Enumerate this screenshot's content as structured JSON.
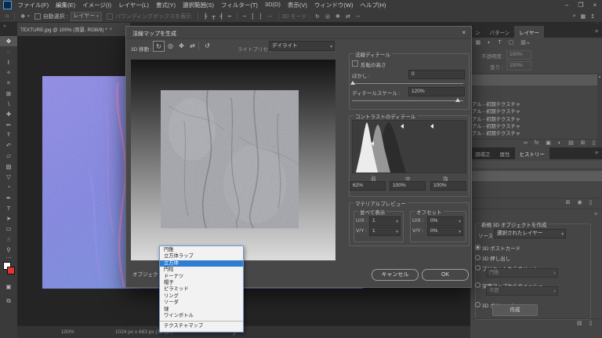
{
  "colors": {
    "accent_blue": "#2e7dd1",
    "selection_highlight": "#2e7dd1",
    "foreground_swatch": "#ffffff",
    "background_swatch": "#e23232",
    "normalmap_base": "#7d7fe4",
    "normalmap_streak": "#ec7fd0"
  },
  "ui": {
    "caret": "▾"
  },
  "window_controls": {
    "minimize": "–",
    "restore": "❐",
    "close": "×"
  },
  "menu_bar": {
    "items": [
      "ファイル(F)",
      "編集(E)",
      "イメージ(I)",
      "レイヤー(L)",
      "書式(Y)",
      "選択範囲(S)",
      "フィルター(T)",
      "3D(D)",
      "表示(V)",
      "ウィンドウ(W)",
      "ヘルプ(H)"
    ]
  },
  "options_bar": {
    "home_icon": "⌂",
    "move_icon": "✥",
    "auto_select_label": "自動選択 :",
    "auto_select_value": "レイヤー",
    "bounding_box_label": "バウンディングボックスを表示",
    "align_icons": [
      "┣",
      "┳",
      "┫",
      "━"
    ],
    "distribute_icons": [
      "┅",
      "┇",
      "┋"
    ],
    "more_icon": "⋯",
    "mode_label": "3D モード :",
    "mode_icons": [
      "↻",
      "◎",
      "✥",
      "⇄",
      "↔"
    ],
    "search_icon": "⌕",
    "layout_icon": "▦",
    "share_icon": "↥"
  },
  "document_tab": {
    "title": "TEXTURE.jpg @ 100% (背景, RGB/8) *",
    "close_icon": "×"
  },
  "toolbar": {
    "collapse_icon": "»",
    "tools": [
      {
        "name": "move",
        "glyph": "✥",
        "selected": true
      },
      {
        "name": "marquee",
        "glyph": "◌"
      },
      {
        "name": "lasso",
        "glyph": "ℓ"
      },
      {
        "name": "quick-select",
        "glyph": "✧"
      },
      {
        "name": "crop",
        "glyph": "⌗"
      },
      {
        "name": "frame",
        "glyph": "⊠"
      },
      {
        "name": "eyedropper",
        "glyph": "∖"
      },
      {
        "name": "healing",
        "glyph": "✚"
      },
      {
        "name": "brush",
        "glyph": "✏"
      },
      {
        "name": "clone-stamp",
        "glyph": "⍒"
      },
      {
        "name": "history-brush",
        "glyph": "↶"
      },
      {
        "name": "eraser",
        "glyph": "▱"
      },
      {
        "name": "gradient",
        "glyph": "▨"
      },
      {
        "name": "blur",
        "glyph": "▽"
      },
      {
        "name": "dodge",
        "glyph": "◔"
      },
      {
        "name": "pen",
        "glyph": "✒"
      },
      {
        "name": "type",
        "glyph": "T"
      },
      {
        "name": "path-select",
        "glyph": "➤"
      },
      {
        "name": "shape",
        "glyph": "▭"
      },
      {
        "name": "hand",
        "glyph": "☝"
      },
      {
        "name": "zoom",
        "glyph": "⚲"
      }
    ],
    "more_icon": "⋯",
    "quickmask_icon": "▣",
    "screenmode_icon": "⧉"
  },
  "dialog": {
    "title": "法線マップを生成",
    "close_icon": "×",
    "move_label": "3D 移動 :",
    "move_icons": [
      "↻",
      "◎",
      "✥",
      "⇄"
    ],
    "reset_icon": "↺",
    "light_preset_label": "ライトプリセット :",
    "light_preset_value": "デイライト",
    "object_label": "オブジェクト :",
    "normal_detail": {
      "title": "法線ディテール",
      "invert_label": "反転の高さ",
      "blur_label": "ぼかし :",
      "blur_value": "0",
      "scale_label": "ディテールスケール :",
      "scale_value": "120%"
    },
    "contrast": {
      "title": "コントラストのディテール",
      "tick_labels": [
        "弱",
        "中",
        "強"
      ],
      "values": [
        "62%",
        "100%",
        "100%"
      ]
    },
    "material": {
      "title": "マテリアルプレビュー",
      "tile": {
        "title": "並べて表示",
        "ux_label": "U/X :",
        "ux_value": "1",
        "vy_label": "V/Y :",
        "vy_value": "1"
      },
      "offset": {
        "title": "オフセット",
        "ux_label": "U/X :",
        "ux_value": "0%",
        "vy_label": "V/Y :",
        "vy_value": "0%"
      }
    },
    "cancel_label": "キャンセル",
    "ok_label": "OK"
  },
  "popup_menu": {
    "items": [
      {
        "label": "円錐"
      },
      {
        "label": "立方体ラップ"
      },
      {
        "label": "立方体",
        "selected": true
      },
      {
        "label": "円柱"
      },
      {
        "label": "ドーナツ"
      },
      {
        "label": "帽子"
      },
      {
        "label": "ピラミッド"
      },
      {
        "label": "リング"
      },
      {
        "label": "ソーダ"
      },
      {
        "label": "球"
      },
      {
        "label": "ワインボトル"
      },
      {
        "label": "テクスチャマップ",
        "separated": true
      }
    ]
  },
  "right_panels": {
    "collapse_icon": "»",
    "panel_menu_icon": "≡",
    "panel_tabs_top": [
      {
        "label": "ン"
      },
      {
        "label": "パターン"
      },
      {
        "label": "レイヤー",
        "active": true
      }
    ],
    "layers": {
      "filter_icons": [
        "▦",
        "◐",
        "T",
        "▢",
        "▥"
      ],
      "pin_icon": "⌖",
      "opacity_label": "不透明度 :",
      "opacity_value": "100%",
      "fill_label": "塗り :",
      "fill_value": "100%",
      "rows": [
        "アル - 初期テクスチャ",
        "アル - 初期テクスチャ",
        "アル - 初期テクスチャ",
        "アル - 初期テクスチャ",
        "アル - 初期テクスチャ"
      ],
      "scroll_up_icon": "▴",
      "bottom_icons": [
        {
          "name": "link",
          "glyph": "∞"
        },
        {
          "name": "effects",
          "glyph": "fx"
        },
        {
          "name": "mask",
          "glyph": "▣"
        },
        {
          "name": "adjustment",
          "glyph": "◐"
        },
        {
          "name": "group",
          "glyph": "▤"
        },
        {
          "name": "new-layer",
          "glyph": "⊞"
        },
        {
          "name": "delete",
          "glyph": "▯"
        }
      ]
    },
    "panel_tabs_mid": [
      {
        "label": "調補正"
      },
      {
        "label": "属性"
      },
      {
        "label": "ヒストリー",
        "active": true
      }
    ],
    "history": {
      "bottom_icons": [
        {
          "name": "new-doc-from-state",
          "glyph": "⊞"
        },
        {
          "name": "snapshot",
          "glyph": "◉"
        },
        {
          "name": "delete",
          "glyph": "▯"
        }
      ]
    },
    "threed": {
      "title": "新規 3D オブジェクトを作成",
      "source_label": "ソース :",
      "source_value": "選択されたレイヤー",
      "options": [
        {
          "label": "3D ポストカード",
          "selected": true
        },
        {
          "label": "3D 押し出し"
        },
        {
          "label": "プリセットからのメッシュ"
        },
        {
          "label": "深度マップからのメッシュ"
        },
        {
          "label": "3D ボリューム"
        }
      ],
      "preset_value": "円錐",
      "depth_value": "平面",
      "create_label": "作成",
      "bottom_icons": [
        {
          "name": "group",
          "glyph": "▤"
        },
        {
          "name": "delete",
          "glyph": "▯"
        }
      ]
    }
  },
  "status_bar": {
    "zoom_value": "100%",
    "doc_info": "1024 px x 683 px (72 ppi)",
    "chevron_icon": "❯"
  }
}
